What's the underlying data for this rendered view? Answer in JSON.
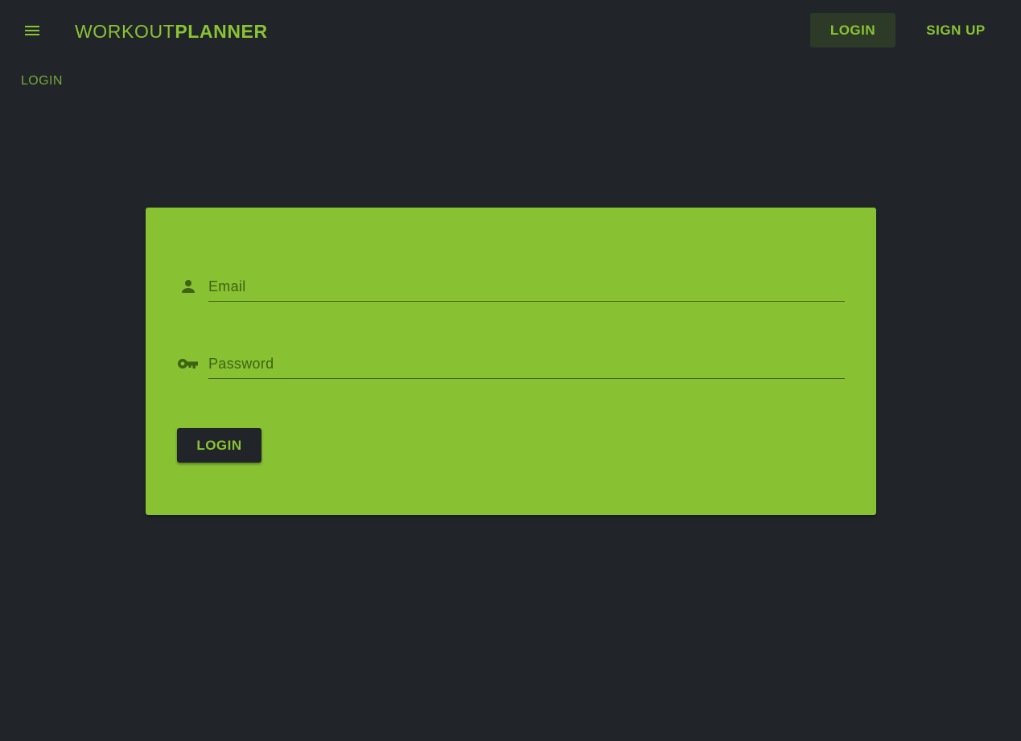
{
  "header": {
    "menu_icon": "hamburger-menu-icon",
    "brand_light": "WORKOUT",
    "brand_bold": "PLANNER",
    "login_label": "LOGIN",
    "signup_label": "SIGN UP"
  },
  "breadcrumb": {
    "current": "LOGIN"
  },
  "form": {
    "email": {
      "icon": "person-icon",
      "placeholder": "Email",
      "value": ""
    },
    "password": {
      "icon": "key-icon",
      "placeholder": "Password",
      "value": ""
    },
    "submit_label": "LOGIN"
  },
  "colors": {
    "background": "#212529",
    "accent": "#8ac333",
    "card": "#88c232",
    "card_text": "#3f6214"
  }
}
